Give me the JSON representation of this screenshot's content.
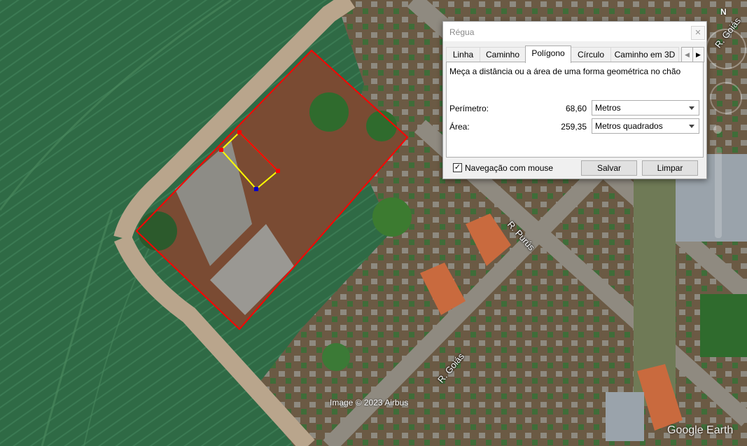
{
  "map": {
    "streets": [
      "R. Goiás",
      "R. Purús",
      "R. Goiás"
    ],
    "attribution": "Image © 2023 Airbus",
    "brand": "Google Earth",
    "north_label": "N"
  },
  "dialog": {
    "title": "Régua",
    "tabs": [
      "Linha",
      "Caminho",
      "Polígono",
      "Círculo",
      "Caminho em 3D"
    ],
    "active_tab": "Polígono",
    "description": "Meça a distância ou a área de uma forma geométrica no chão",
    "perimeter": {
      "label": "Perímetro:",
      "value": "68,60",
      "unit": "Metros"
    },
    "area": {
      "label": "Área:",
      "value": "259,35",
      "unit": "Metros quadrados"
    },
    "mouse_nav": {
      "label": "Navegação com mouse",
      "checked": true
    },
    "buttons": {
      "save": "Salvar",
      "clear": "Limpar"
    }
  },
  "colors": {
    "polygon_outer": "#ff0000",
    "polygon_inner": "#ffff00"
  }
}
